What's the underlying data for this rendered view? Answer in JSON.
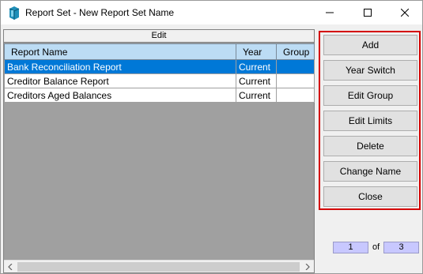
{
  "window": {
    "title": "Report Set - New Report Set Name"
  },
  "grid": {
    "caption": "Edit",
    "columns": [
      "Report Name",
      "Year",
      "Group"
    ],
    "rows": [
      {
        "name": "Bank Reconciliation Report",
        "year": "Current",
        "group": "",
        "selected": true
      },
      {
        "name": "Creditor Balance Report",
        "year": "Current",
        "group": "",
        "selected": false
      },
      {
        "name": "Creditors Aged Balances",
        "year": "Current",
        "group": "",
        "selected": false
      }
    ]
  },
  "buttons": {
    "add": "Add",
    "year_switch": "Year Switch",
    "edit_group": "Edit Group",
    "edit_limits": "Edit Limits",
    "delete": "Delete",
    "change_name": "Change Name",
    "close": "Close"
  },
  "pager": {
    "current": "1",
    "of_label": "of",
    "total": "3"
  },
  "colors": {
    "selection": "#0078d7",
    "header_bg": "#bcdcf4",
    "highlight_border": "#d40000",
    "pager_bg": "#c8c8ff",
    "grid_bg": "#a0a0a0"
  }
}
